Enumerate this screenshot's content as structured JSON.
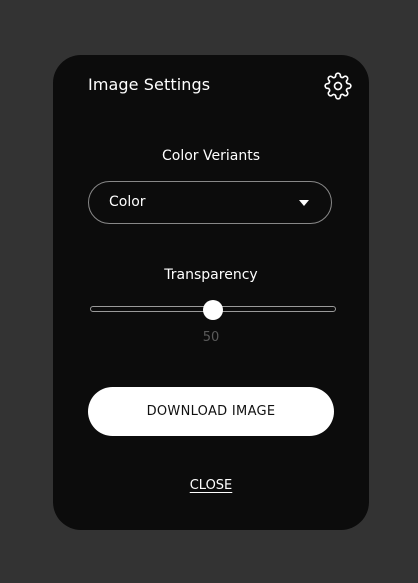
{
  "card": {
    "title": "Image Settings",
    "settings_icon": "gear-icon"
  },
  "color_variants": {
    "label": "Color Veriants",
    "selected": "Color",
    "caret_icon": "caret-down-icon"
  },
  "transparency": {
    "label": "Transparency",
    "value": 50,
    "value_text": "50",
    "min": 0,
    "max": 100
  },
  "actions": {
    "download_label": "DOWNLOAD IMAGE",
    "close_label": "CLOSE"
  },
  "colors": {
    "page_background": "#333333",
    "card_background": "#0c0c0c",
    "accent": "#ffffff"
  }
}
